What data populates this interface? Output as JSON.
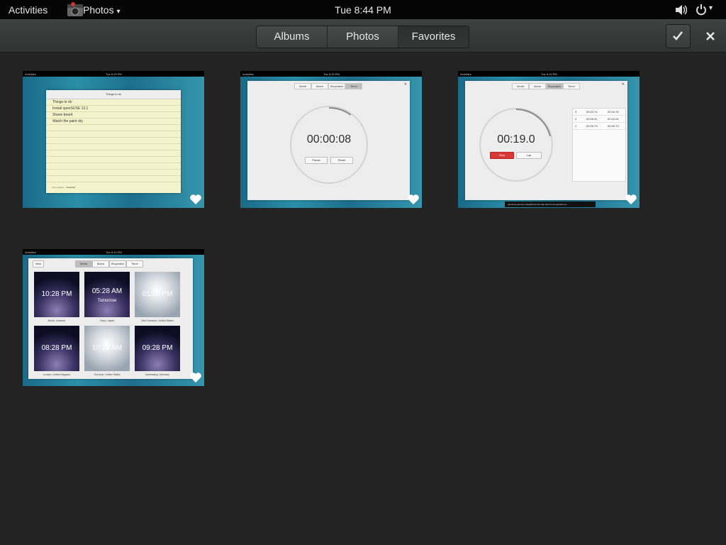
{
  "topbar": {
    "activities": "Activities",
    "app_name": "Photos",
    "app_caret": "▾",
    "clock": "Tue  8:44 PM",
    "power_caret": "▾"
  },
  "header": {
    "tabs": [
      {
        "label": "Albums",
        "active": false
      },
      {
        "label": "Photos",
        "active": false
      },
      {
        "label": "Favorites",
        "active": true
      }
    ],
    "select_icon": "check-icon",
    "close_icon": "close-icon"
  },
  "thumbnails": {
    "mini_topbar": {
      "activities": "Activities",
      "clock": "Tue  8:19 PM"
    },
    "notes": {
      "window_title": "Things to do",
      "lines": [
        "Things to do",
        "Install openSUSE 13.1",
        "Shave beard",
        "Watch the paint dry"
      ],
      "footer_left": "Last updated",
      "footer_right": "Yesterday"
    },
    "timer": {
      "tabs": [
        "World",
        "Alarm",
        "Stopwatch",
        "Timer"
      ],
      "time": "00:00:08",
      "buttons": [
        "Pause",
        "Reset"
      ],
      "progress": 0.1
    },
    "stopwatch": {
      "tabs": [
        "World",
        "Alarm",
        "Stopwatch",
        "Timer"
      ],
      "time": "00:19.0",
      "buttons": [
        "Stop",
        "Lap"
      ],
      "laps": [
        {
          "n": "3",
          "split": "00:02.74",
          "total": "00:18.78"
        },
        {
          "n": "2",
          "split": "00:06.31",
          "total": "00:16.04"
        },
        {
          "n": "1",
          "split": "00:09.73",
          "total": "00:09.73"
        }
      ],
      "notification": "opensuse-gnome-margarita  by the way how to use gestures to..."
    },
    "world": {
      "header_button": "New",
      "tabs": [
        "World",
        "Alarm",
        "Stopwatch",
        "Timer"
      ],
      "cities": [
        {
          "time": "10:28 PM",
          "sub": "",
          "label": "Beirut, Lebanon",
          "style": "night"
        },
        {
          "time": "05:28 AM",
          "sub": "Tomorrow",
          "label": "Tokyo, Japan",
          "style": "night"
        },
        {
          "time": "01:28 PM",
          "sub": "",
          "label": "San Francisco, United States",
          "style": "day"
        },
        {
          "time": "08:28 PM",
          "sub": "",
          "label": "London, United Kingdom",
          "style": "night"
        },
        {
          "time": "10:28 AM",
          "sub": "",
          "label": "Honolulu, United States",
          "style": "day"
        },
        {
          "time": "09:28 PM",
          "sub": "",
          "label": "Nuremberg, Germany",
          "style": "night"
        }
      ]
    }
  },
  "colors": {
    "stop_button": "#d93636",
    "accent_tab_active": "#2f3331"
  }
}
